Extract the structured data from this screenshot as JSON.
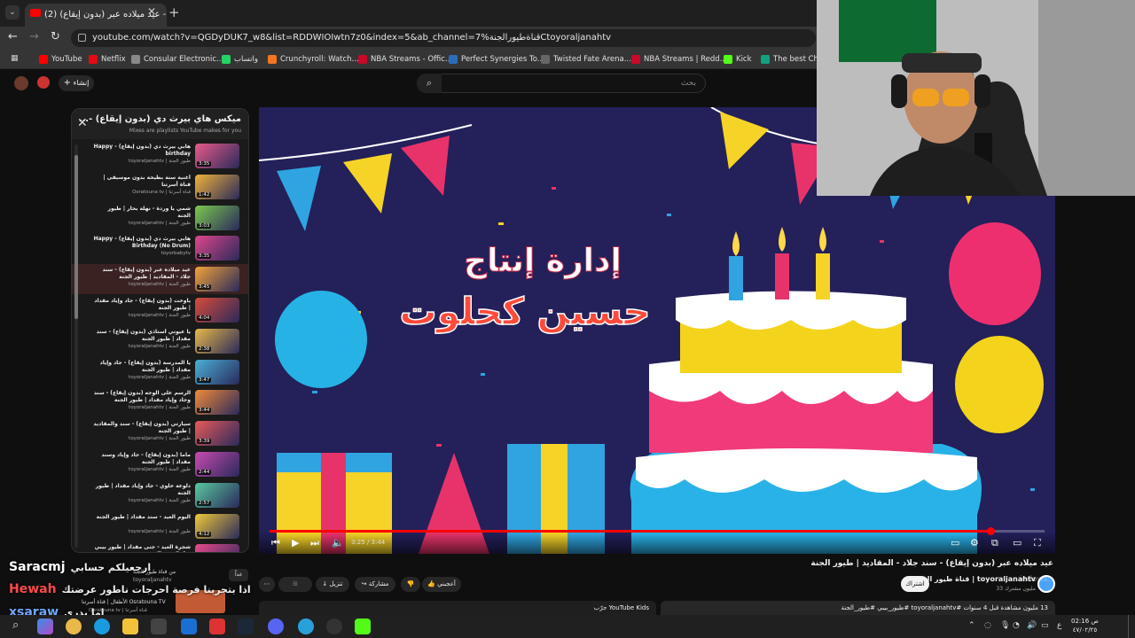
{
  "browser": {
    "tab_title": "(2) عيد ميلاده عبر (بدون إيقاع) - ...",
    "url": "youtube.com/watch?v=QGDyDUK7_w8&list=RDDWIOIwtn7z0&index=5&ab_channel=7%قناةطيورالجنةCtoyoraljanahtv",
    "bookmarks": [
      "YouTube",
      "Netflix",
      "Consular Electronic...",
      "واتساب",
      "Crunchyroll: Watch...",
      "NBA Streams - Offic...",
      "Perfect Synergies To...",
      "Twisted Fate Arena...",
      "NBA Streams | Redd...",
      "Kick",
      "The best ChatB"
    ],
    "bookmark_colors": [
      "#ff0000",
      "#e50914",
      "#888888",
      "#25d366",
      "#f47521",
      "#c9082a",
      "#2a6ebb",
      "#666666",
      "#c9082a",
      "#53fc18",
      "#10a37f"
    ]
  },
  "youtube": {
    "search_placeholder": "بحث",
    "create_label": "إنشاء",
    "playlist": {
      "title": "ميكس هاي بيرث دي (بدون إيقاع) -...",
      "subtitle": "Mixes are playlists YouTube makes for you",
      "items": [
        {
          "title": "هابي بيرث دي (بدون إيقاع) - Happy birthday",
          "channel": "toyoraljanahtv | طيور الجنة",
          "duration": "3:35",
          "color": "#e85a8a"
        },
        {
          "title": "أغنية سنة بطيخة بدون موسيقى | قناة أسرتنا",
          "channel": "Osratouna tv | قناة أسرتنا",
          "duration": "1:42",
          "color": "#f0b23c"
        },
        {
          "title": "شمي يا وردة - نهلة بحار | طيور الجنة",
          "channel": "toyoraljanahtv | طيور الجنة",
          "duration": "3:03",
          "color": "#7cc84f"
        },
        {
          "title": "هابي بيرث دي (بدون إيقاع) - Happy Birthday (No Drum)",
          "channel": "toyorbabytv",
          "duration": "3:35",
          "color": "#e0468c"
        },
        {
          "title": "عيد ميلاده عبر (بدون إيقاع) - سند جلاد - المقاديد | طيور الجنة",
          "channel": "toyoraljanahtv | طيور الجنة",
          "duration": "3:45",
          "color": "#f2a33a"
        },
        {
          "title": "ياوخت (بدون إيقاع) - جاد وإياد مقداد | طيور الجنة",
          "channel": "toyoraljanahtv | طيور الجنة",
          "duration": "4:04",
          "color": "#d84b3a"
        },
        {
          "title": "يا عيوني أستاذي (بدون إيقاع) - سند مقداد | طيور الجنة",
          "channel": "toyoraljanahtv | طيور الجنة",
          "duration": "2:38",
          "color": "#e8b84a"
        },
        {
          "title": "يا المدرسة (بدون إيقاع) - جاد وإياد مقداد | طيور الجنة",
          "channel": "toyoraljanahtv | طيور الجنة",
          "duration": "3:47",
          "color": "#4ab0d8"
        },
        {
          "title": "الرسم على الوجه (بدون إيقاع) - سند وجاد وإياد مقداد | طيور الجنة",
          "channel": "toyoraljanahtv | طيور الجنة",
          "duration": "3:44",
          "color": "#f08a3a"
        },
        {
          "title": "سيارتي (بدون إيقاع) - سند والمقاديد | طيور الجنة",
          "channel": "toyoraljanahtv | طيور الجنة",
          "duration": "3:39",
          "color": "#e85a5a"
        },
        {
          "title": "ماما (بدون إيقاع) - جاد وإياد وسند مقداد | طيور الجنة",
          "channel": "toyoraljanahtv | طيور الجنة",
          "duration": "2:44",
          "color": "#c84ab0"
        },
        {
          "title": "دلوعة خلوي - جاد وإياد مقداد | طيور الجنة",
          "channel": "toyoraljanahtv | طيور الجنة",
          "duration": "2:57",
          "color": "#5ac8a0"
        },
        {
          "title": "اليوم العيد - سند مقداد | طيور الجنة",
          "channel": "toyoraljanahtv | طيور الجنة",
          "duration": "4:12",
          "color": "#f0c83a"
        },
        {
          "title": "شجرة العيد - جنى مقداد | طيور بيبي Toyor Baby",
          "channel": "toyorbabytv",
          "duration": "",
          "color": "#e84a8a"
        }
      ]
    },
    "video": {
      "overlay_line1": "إدارة إنتاج",
      "overlay_line2": "حسين كحلوت",
      "time": "3:25 / 3:44",
      "progress": 0.93,
      "title": "عيد ميلاده عبر (بدون إيقاع) - سند جلاد - المقاديد | طيور الجنة",
      "channel": "toyoraljanahtv | قناة طيور الجنة",
      "subscribers": "33 مليون مشترك",
      "subscribe_label": "اشتراك",
      "like_label": "أعجبني",
      "share_label": "مشاركة",
      "download_label": "تنزيل",
      "description": "13 مليون مشاهدة قبل 4 سنوات #toyoraljanahtv #طيور_بيبي #طيور_الجنة",
      "youtube_kids": "جرّب YouTube Kids",
      "watermark": "indows.",
      "upnext_label": "من قناة طيور الجنة",
      "upnext_channel": "toyoraljanahtv",
      "upnext_badge": "غداً",
      "upnext_title2": "الأطفال | قناة أسرتنا Osratouna TV",
      "upnext_channel2": "Osratouna tv | قناة أسرتنا"
    }
  },
  "chat": [
    {
      "user": "Saracmj",
      "message": "ارجعيلكم حسابي",
      "color": "#ffffff"
    },
    {
      "user": "Hewah",
      "message": "اذا بتجربنا فرصة احرجات ناطور عرضتك",
      "color": "#ff4a4a"
    },
    {
      "user": "xsaraw",
      "message": "اما بدري",
      "color": "#6fa8ff"
    }
  ],
  "taskbar": {
    "time": "02:16 ص",
    "date": "٤٧/٠٢/٢٥",
    "lang": "ع"
  }
}
